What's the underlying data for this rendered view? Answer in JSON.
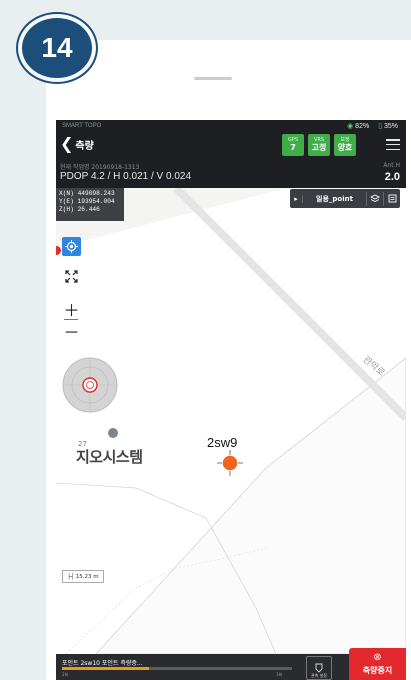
{
  "step_number": "14",
  "status_bar": {
    "carrier": "SMART TOPO",
    "signal": "82%",
    "battery": "35%"
  },
  "toolbar": {
    "title": "측량",
    "badges": [
      {
        "top": "GPS",
        "bottom": "7"
      },
      {
        "top": "VRS",
        "bottom": "고정"
      },
      {
        "top": "보정",
        "bottom": "양호"
      }
    ]
  },
  "info": {
    "label": "현재 작업명 20190918-1313",
    "pdop": "PDOP 4.2 / H 0.021 / V 0.024",
    "ant_label": "Ant.H",
    "ant_value": "2.0"
  },
  "coords": {
    "x": "X(N) 449098.243",
    "y": "Y(E) 193954.004",
    "z": "Z(H) 26.446"
  },
  "layer_bar": {
    "label": "일용_point"
  },
  "map": {
    "point_label": "2sw9",
    "place_number": "27",
    "place_name": "지오시스템",
    "road_name": "관악로",
    "scale": "15.23 m"
  },
  "bottom": {
    "message": "포인트 2sw10 포인트 측량중...",
    "progress": 0.38,
    "progress_left": "2회",
    "progress_right": "3회",
    "ctrl_label": "관측 설정",
    "stop_label": "측량중지"
  },
  "colors": {
    "badge": "#1b4e7a",
    "gps_green": "#3fae49",
    "stop_red": "#e3282e",
    "point_orange": "#f2641d",
    "progress": "#e0a11a"
  }
}
